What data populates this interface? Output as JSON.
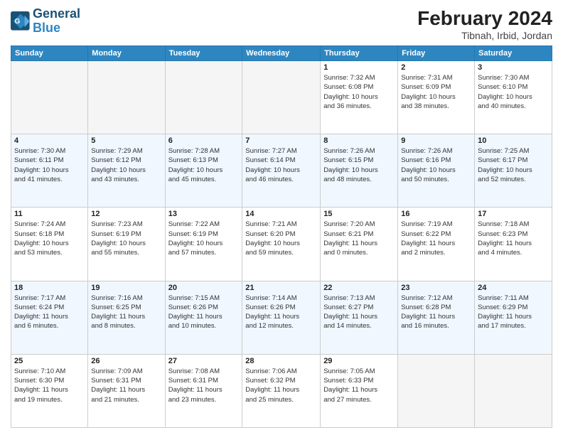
{
  "header": {
    "logo_line1": "General",
    "logo_line2": "Blue",
    "month_title": "February 2024",
    "location": "Tibnah, Irbid, Jordan"
  },
  "days_of_week": [
    "Sunday",
    "Monday",
    "Tuesday",
    "Wednesday",
    "Thursday",
    "Friday",
    "Saturday"
  ],
  "weeks": [
    [
      {
        "day": "",
        "info": ""
      },
      {
        "day": "",
        "info": ""
      },
      {
        "day": "",
        "info": ""
      },
      {
        "day": "",
        "info": ""
      },
      {
        "day": "1",
        "info": "Sunrise: 7:32 AM\nSunset: 6:08 PM\nDaylight: 10 hours\nand 36 minutes."
      },
      {
        "day": "2",
        "info": "Sunrise: 7:31 AM\nSunset: 6:09 PM\nDaylight: 10 hours\nand 38 minutes."
      },
      {
        "day": "3",
        "info": "Sunrise: 7:30 AM\nSunset: 6:10 PM\nDaylight: 10 hours\nand 40 minutes."
      }
    ],
    [
      {
        "day": "4",
        "info": "Sunrise: 7:30 AM\nSunset: 6:11 PM\nDaylight: 10 hours\nand 41 minutes."
      },
      {
        "day": "5",
        "info": "Sunrise: 7:29 AM\nSunset: 6:12 PM\nDaylight: 10 hours\nand 43 minutes."
      },
      {
        "day": "6",
        "info": "Sunrise: 7:28 AM\nSunset: 6:13 PM\nDaylight: 10 hours\nand 45 minutes."
      },
      {
        "day": "7",
        "info": "Sunrise: 7:27 AM\nSunset: 6:14 PM\nDaylight: 10 hours\nand 46 minutes."
      },
      {
        "day": "8",
        "info": "Sunrise: 7:26 AM\nSunset: 6:15 PM\nDaylight: 10 hours\nand 48 minutes."
      },
      {
        "day": "9",
        "info": "Sunrise: 7:26 AM\nSunset: 6:16 PM\nDaylight: 10 hours\nand 50 minutes."
      },
      {
        "day": "10",
        "info": "Sunrise: 7:25 AM\nSunset: 6:17 PM\nDaylight: 10 hours\nand 52 minutes."
      }
    ],
    [
      {
        "day": "11",
        "info": "Sunrise: 7:24 AM\nSunset: 6:18 PM\nDaylight: 10 hours\nand 53 minutes."
      },
      {
        "day": "12",
        "info": "Sunrise: 7:23 AM\nSunset: 6:19 PM\nDaylight: 10 hours\nand 55 minutes."
      },
      {
        "day": "13",
        "info": "Sunrise: 7:22 AM\nSunset: 6:19 PM\nDaylight: 10 hours\nand 57 minutes."
      },
      {
        "day": "14",
        "info": "Sunrise: 7:21 AM\nSunset: 6:20 PM\nDaylight: 10 hours\nand 59 minutes."
      },
      {
        "day": "15",
        "info": "Sunrise: 7:20 AM\nSunset: 6:21 PM\nDaylight: 11 hours\nand 0 minutes."
      },
      {
        "day": "16",
        "info": "Sunrise: 7:19 AM\nSunset: 6:22 PM\nDaylight: 11 hours\nand 2 minutes."
      },
      {
        "day": "17",
        "info": "Sunrise: 7:18 AM\nSunset: 6:23 PM\nDaylight: 11 hours\nand 4 minutes."
      }
    ],
    [
      {
        "day": "18",
        "info": "Sunrise: 7:17 AM\nSunset: 6:24 PM\nDaylight: 11 hours\nand 6 minutes."
      },
      {
        "day": "19",
        "info": "Sunrise: 7:16 AM\nSunset: 6:25 PM\nDaylight: 11 hours\nand 8 minutes."
      },
      {
        "day": "20",
        "info": "Sunrise: 7:15 AM\nSunset: 6:26 PM\nDaylight: 11 hours\nand 10 minutes."
      },
      {
        "day": "21",
        "info": "Sunrise: 7:14 AM\nSunset: 6:26 PM\nDaylight: 11 hours\nand 12 minutes."
      },
      {
        "day": "22",
        "info": "Sunrise: 7:13 AM\nSunset: 6:27 PM\nDaylight: 11 hours\nand 14 minutes."
      },
      {
        "day": "23",
        "info": "Sunrise: 7:12 AM\nSunset: 6:28 PM\nDaylight: 11 hours\nand 16 minutes."
      },
      {
        "day": "24",
        "info": "Sunrise: 7:11 AM\nSunset: 6:29 PM\nDaylight: 11 hours\nand 17 minutes."
      }
    ],
    [
      {
        "day": "25",
        "info": "Sunrise: 7:10 AM\nSunset: 6:30 PM\nDaylight: 11 hours\nand 19 minutes."
      },
      {
        "day": "26",
        "info": "Sunrise: 7:09 AM\nSunset: 6:31 PM\nDaylight: 11 hours\nand 21 minutes."
      },
      {
        "day": "27",
        "info": "Sunrise: 7:08 AM\nSunset: 6:31 PM\nDaylight: 11 hours\nand 23 minutes."
      },
      {
        "day": "28",
        "info": "Sunrise: 7:06 AM\nSunset: 6:32 PM\nDaylight: 11 hours\nand 25 minutes."
      },
      {
        "day": "29",
        "info": "Sunrise: 7:05 AM\nSunset: 6:33 PM\nDaylight: 11 hours\nand 27 minutes."
      },
      {
        "day": "",
        "info": ""
      },
      {
        "day": "",
        "info": ""
      }
    ]
  ]
}
